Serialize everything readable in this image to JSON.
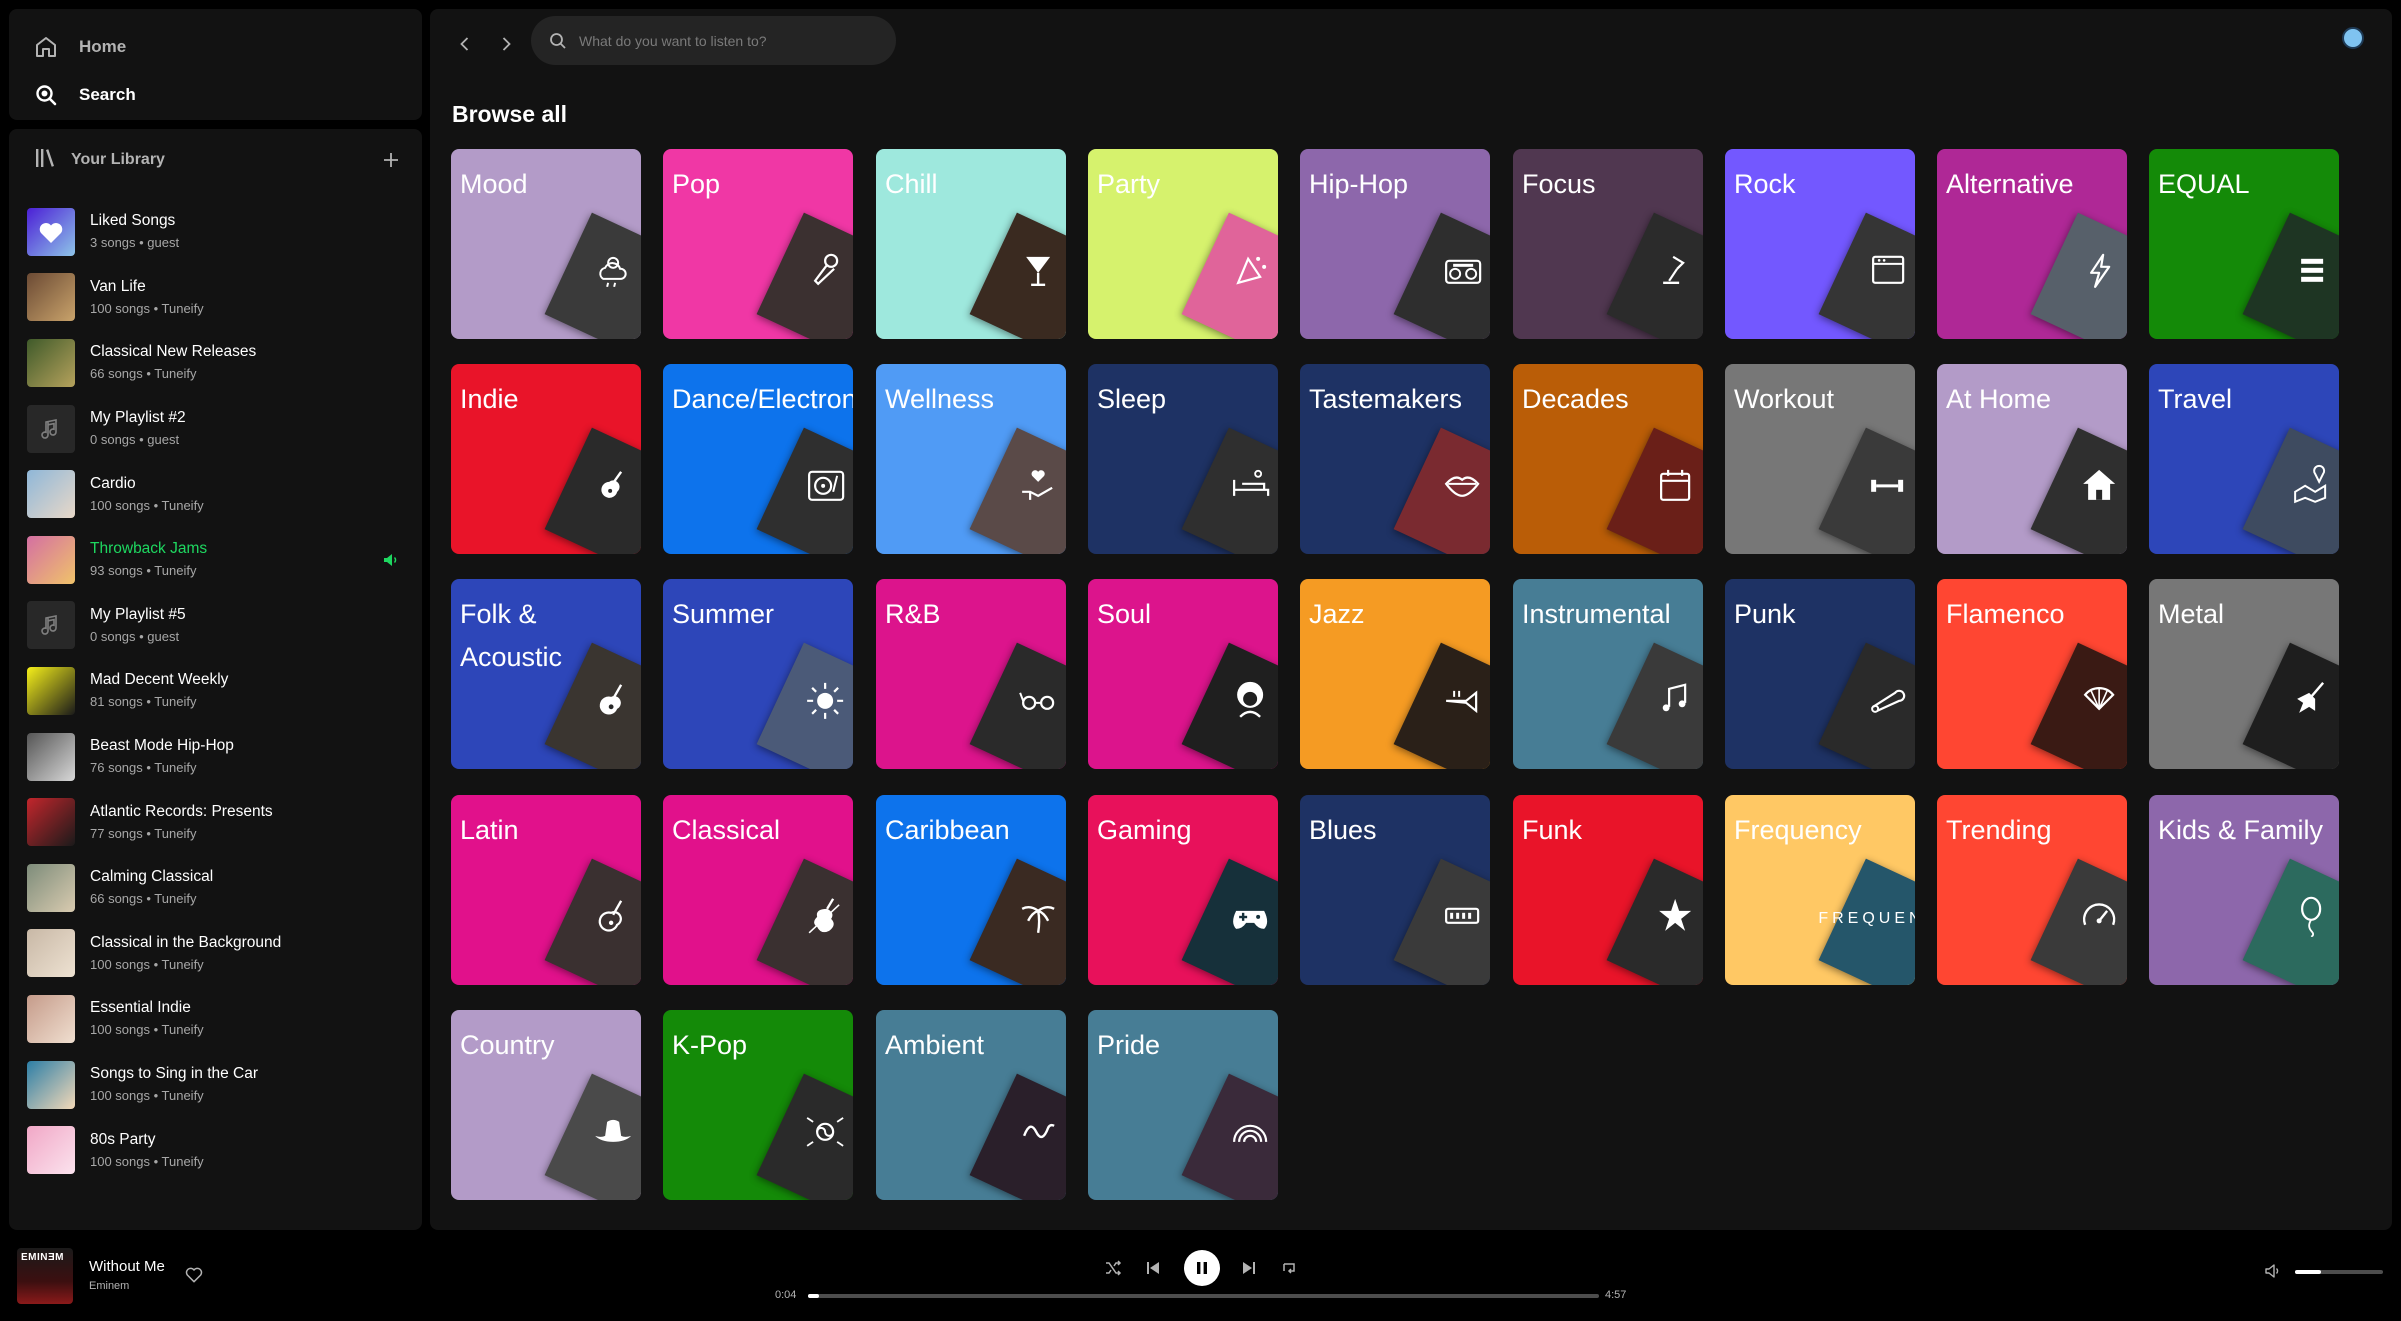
{
  "nav": {
    "home_label": "Home",
    "search_label": "Search"
  },
  "library": {
    "title": "Your Library",
    "items": [
      {
        "title": "Liked Songs",
        "subtitle": "3 songs • guest",
        "icon": "heart-icon",
        "colors": [
          "#4b1fd6",
          "#8ec5e8"
        ]
      },
      {
        "title": "Van Life",
        "subtitle": "100 songs • Tuneify",
        "icon": "photo",
        "colors": [
          "#6b4a34",
          "#c9a36b"
        ]
      },
      {
        "title": "Classical New Releases",
        "subtitle": "66 songs • Tuneify",
        "icon": "photo",
        "colors": [
          "#3f5a2a",
          "#b6a25c"
        ]
      },
      {
        "title": "My Playlist #2",
        "subtitle": "0 songs • guest",
        "icon": "music-note-icon",
        "colors": [
          "#282828",
          "#282828"
        ]
      },
      {
        "title": "Cardio",
        "subtitle": "100 songs • Tuneify",
        "icon": "photo",
        "colors": [
          "#8fb7d8",
          "#e8d8c8"
        ]
      },
      {
        "title": "Throwback Jams",
        "subtitle": "93 songs • Tuneify",
        "icon": "photo",
        "colors": [
          "#d46fa2",
          "#f0c36a"
        ]
      },
      {
        "title": "My Playlist #5",
        "subtitle": "0 songs • guest",
        "icon": "music-note-icon",
        "colors": [
          "#282828",
          "#282828"
        ]
      },
      {
        "title": "Mad Decent Weekly",
        "subtitle": "81 songs • Tuneify",
        "icon": "photo",
        "colors": [
          "#f6f01a",
          "#1a1a1a"
        ]
      },
      {
        "title": "Beast Mode Hip-Hop",
        "subtitle": "76 songs • Tuneify",
        "icon": "photo",
        "colors": [
          "#555555",
          "#d8d8d8"
        ]
      },
      {
        "title": "Atlantic Records: Presents",
        "subtitle": "77 songs • Tuneify",
        "icon": "photo",
        "colors": [
          "#c3262c",
          "#1a1a1a"
        ]
      },
      {
        "title": "Calming Classical",
        "subtitle": "66 songs • Tuneify",
        "icon": "photo",
        "colors": [
          "#7d8c7a",
          "#d9cbb0"
        ]
      },
      {
        "title": "Classical in the Background",
        "subtitle": "100 songs • Tuneify",
        "icon": "photo",
        "colors": [
          "#c8b8a6",
          "#eee2d2"
        ]
      },
      {
        "title": "Essential Indie",
        "subtitle": "100 songs • Tuneify",
        "icon": "photo",
        "colors": [
          "#c59b8a",
          "#f0dfd0"
        ]
      },
      {
        "title": "Songs to Sing in the Car",
        "subtitle": "100 songs • Tuneify",
        "icon": "photo",
        "colors": [
          "#2c7ea6",
          "#f4d9b8"
        ]
      },
      {
        "title": "80s Party",
        "subtitle": "100 songs • Tuneify",
        "icon": "photo",
        "colors": [
          "#f1a7c6",
          "#fbe3ee"
        ]
      }
    ],
    "playing_index": 5
  },
  "search": {
    "placeholder": "What do you want to listen to?"
  },
  "browse": {
    "title": "Browse all",
    "categories": [
      {
        "name": "Mood",
        "color": "#b39bc8",
        "tile": "#3a3a3a",
        "icon": "cloud-sun-icon"
      },
      {
        "name": "Pop",
        "color": "#f037a5",
        "tile": "#3b3030",
        "icon": "microphone-icon"
      },
      {
        "name": "Chill",
        "color": "#9ee8dd",
        "tile": "#3a2a20",
        "icon": "cocktail-icon"
      },
      {
        "name": "Party",
        "color": "#d6f26d",
        "tile": "#e0649a",
        "icon": "party-icon"
      },
      {
        "name": "Hip-Hop",
        "color": "#8d67ab",
        "tile": "#2e2e2e",
        "icon": "boombox-icon"
      },
      {
        "name": "Focus",
        "color": "#503750",
        "tile": "#2b2b2b",
        "icon": "lamp-icon"
      },
      {
        "name": "Rock",
        "color": "#7358ff",
        "tile": "#353535",
        "icon": "amp-icon"
      },
      {
        "name": "Alternative",
        "color": "#af2896",
        "tile": "#57606a",
        "icon": "lightning-icon"
      },
      {
        "name": "EQUAL",
        "color": "#148a08",
        "tile": "#1e3523",
        "icon": "equal-icon"
      },
      {
        "name": "Indie",
        "color": "#e91429",
        "tile": "#2a2a2a",
        "icon": "guitar-icon"
      },
      {
        "name": "Dance/Electronic",
        "color": "#0d73ec",
        "tile": "#2f2f2f",
        "icon": "turntable-icon"
      },
      {
        "name": "Wellness",
        "color": "#509bf5",
        "tile": "#5a4a48",
        "icon": "hand-heart-icon"
      },
      {
        "name": "Sleep",
        "color": "#1e3264",
        "tile": "#2f2f2f",
        "icon": "bed-icon"
      },
      {
        "name": "Tastemakers",
        "color": "#1e3264",
        "tile": "#7a2a30",
        "icon": "lips-icon"
      },
      {
        "name": "Decades",
        "color": "#ba5d07",
        "tile": "#6a1f18",
        "icon": "calendar-icon"
      },
      {
        "name": "Workout",
        "color": "#777777",
        "tile": "#3a3a3a",
        "icon": "dumbbell-icon"
      },
      {
        "name": "At Home",
        "color": "#b39bc8",
        "tile": "#2f2f2f",
        "icon": "house-icon"
      },
      {
        "name": "Travel",
        "color": "#2d46b9",
        "tile": "#3e4b60",
        "icon": "map-pin-icon"
      },
      {
        "name": "Folk & Acoustic",
        "color": "#2d46b9",
        "tile": "#3a3530",
        "icon": "acoustic-guitar-icon"
      },
      {
        "name": "Summer",
        "color": "#2d46b9",
        "tile": "#4b5a78",
        "icon": "sun-icon"
      },
      {
        "name": "R&B",
        "color": "#dc148c",
        "tile": "#2a2a2a",
        "icon": "glasses-icon"
      },
      {
        "name": "Soul",
        "color": "#dc148c",
        "tile": "#1f1f1f",
        "icon": "afro-icon"
      },
      {
        "name": "Jazz",
        "color": "#f59b23",
        "tile": "#2a2018",
        "icon": "trumpet-icon"
      },
      {
        "name": "Instrumental",
        "color": "#477d95",
        "tile": "#3a3a3a",
        "icon": "notes-icon"
      },
      {
        "name": "Punk",
        "color": "#1e3264",
        "tile": "#2a2a2a",
        "icon": "safety-pin-icon"
      },
      {
        "name": "Flamenco",
        "color": "#ff4632",
        "tile": "#3a1a14",
        "icon": "fan-icon"
      },
      {
        "name": "Metal",
        "color": "#777777",
        "tile": "#1e1e1e",
        "icon": "metal-guitar-icon"
      },
      {
        "name": "Latin",
        "color": "#e1118b",
        "tile": "#3a3030",
        "icon": "latin-guitar-icon"
      },
      {
        "name": "Classical",
        "color": "#e1118b",
        "tile": "#3a3030",
        "icon": "violin-icon"
      },
      {
        "name": "Caribbean",
        "color": "#0d73ec",
        "tile": "#3a2a22",
        "icon": "palm-tree-icon"
      },
      {
        "name": "Gaming",
        "color": "#e8115b",
        "tile": "#16303a",
        "icon": "gamepad-icon"
      },
      {
        "name": "Blues",
        "color": "#1e3264",
        "tile": "#3a3a3a",
        "icon": "harmonica-icon"
      },
      {
        "name": "Funk",
        "color": "#e91429",
        "tile": "#2a2a2a",
        "icon": "star-icon"
      },
      {
        "name": "Frequency",
        "color": "#ffc864",
        "tile": "#25566a",
        "icon": "frequency-text-icon",
        "tile_text": "FREQUENCY"
      },
      {
        "name": "Trending",
        "color": "#ff4632",
        "tile": "#3a3a3a",
        "icon": "gauge-icon"
      },
      {
        "name": "Kids & Family",
        "color": "#8d67ab",
        "tile": "#2c6a5e",
        "icon": "balloon-icon"
      },
      {
        "name": "Country",
        "color": "#b39bc8",
        "tile": "#4a4a4a",
        "icon": "cowboy-hat-icon"
      },
      {
        "name": "K-Pop",
        "color": "#148a08",
        "tile": "#2a2a2a",
        "icon": "korea-flag-icon"
      },
      {
        "name": "Ambient",
        "color": "#477d95",
        "tile": "#2a1f2a",
        "icon": "wave-icon"
      },
      {
        "name": "Pride",
        "color": "#477d95",
        "tile": "#3a2a3a",
        "icon": "rainbow-icon"
      }
    ]
  },
  "player": {
    "title": "Without Me",
    "artist": "Eminem",
    "art_logo": "EMINƎM",
    "elapsed": "0:04",
    "duration": "4:57",
    "progress_fraction": 0.0135,
    "volume_fraction": 0.3
  }
}
